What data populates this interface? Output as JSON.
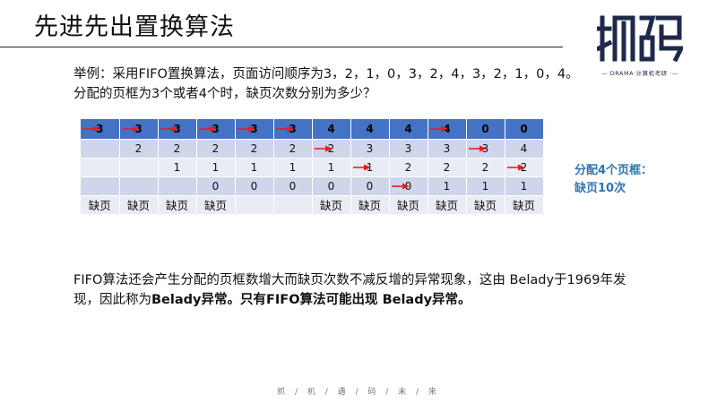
{
  "title": "先进先出置换算法",
  "logo": {
    "text": "抓码",
    "subtitle": "— DRAMA·计算机考研 ·—"
  },
  "question": "举例：采用FIFO置换算法，页面访问顺序为3，2，1，0，3，2，4，3，2，1，0，4。分配的页框为3个或者4个时，缺页次数分别为多少？",
  "table": {
    "rows": [
      [
        "3",
        "3",
        "3",
        "3",
        "3",
        "3",
        "4",
        "4",
        "4",
        "4",
        "0",
        "0"
      ],
      [
        "",
        "2",
        "2",
        "2",
        "2",
        "2",
        "2",
        "3",
        "3",
        "3",
        "3",
        "4"
      ],
      [
        "",
        "",
        "1",
        "1",
        "1",
        "1",
        "1",
        "1",
        "2",
        "2",
        "2",
        "2"
      ],
      [
        "",
        "",
        "",
        "0",
        "0",
        "0",
        "0",
        "0",
        "0",
        "1",
        "1",
        "1"
      ],
      [
        "缺页",
        "缺页",
        "缺页",
        "缺页",
        "",
        "",
        "缺页",
        "缺页",
        "缺页",
        "缺页",
        "缺页",
        "缺页"
      ]
    ],
    "arrows": [
      [
        0,
        0
      ],
      [
        0,
        1
      ],
      [
        0,
        2
      ],
      [
        0,
        3
      ],
      [
        0,
        4
      ],
      [
        0,
        5
      ],
      [
        0,
        9
      ],
      [
        1,
        6
      ],
      [
        1,
        10
      ],
      [
        2,
        7
      ],
      [
        2,
        11
      ],
      [
        3,
        8
      ]
    ],
    "arrow_color": "#e02020"
  },
  "side_note": {
    "line1": "分配4个页框：",
    "line2": "缺页10次"
  },
  "description": {
    "part1": "FIFO算法还会产生分配的页框数增大而缺页次数不减反增的异常现象，这由 Belady于1969年发现，因此称为",
    "bold1": "Belady异常。",
    "bold2": "只有FIFO算法可能出现 Belady异常。"
  },
  "footer": "抓 / 机 / 遇 / 码 / 未 / 来"
}
